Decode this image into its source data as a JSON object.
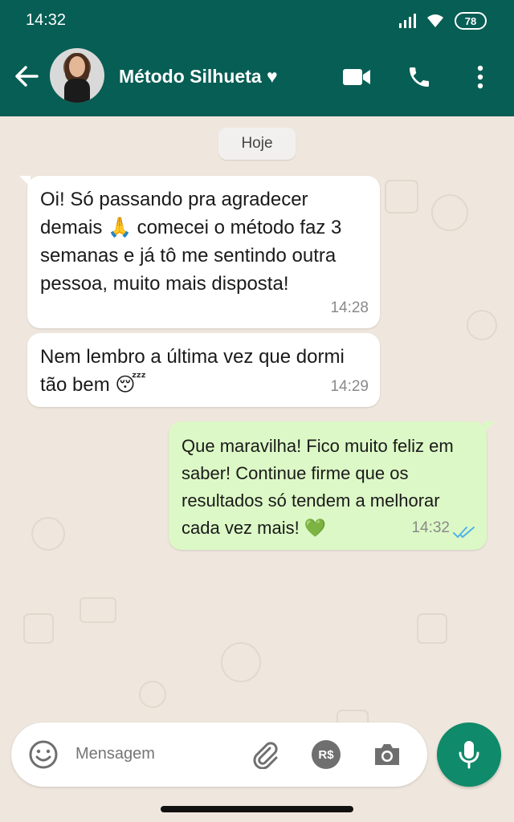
{
  "status_bar": {
    "time": "14:32",
    "battery": "78"
  },
  "header": {
    "contact_name": "Método Silhueta",
    "heart": "♥",
    "icons": [
      "back-arrow-icon",
      "video-call-icon",
      "phone-icon",
      "more-options-icon"
    ]
  },
  "chat": {
    "date_label": "Hoje",
    "messages": [
      {
        "direction": "incoming",
        "text": "Oi! Só passando pra agradecer demais 🙏 comecei o método faz 3 semanas e já tô me sentindo outra pessoa, muito mais disposta!",
        "time": "14:28"
      },
      {
        "direction": "incoming",
        "text": "Nem lembro a última vez que dormi tão bem 😴",
        "time": "14:29"
      },
      {
        "direction": "outgoing",
        "text": "Que maravilha! Fico muito feliz em saber! Continue firme que os resultados só tendem a melhorar cada vez mais! 💚",
        "time": "14:32",
        "status": "read"
      }
    ]
  },
  "composer": {
    "placeholder": "Mensagem",
    "payment_label": "R$",
    "icons": [
      "emoji-icon",
      "attach-icon",
      "payment-icon",
      "camera-icon",
      "mic-icon"
    ]
  },
  "colors": {
    "header": "#075e54",
    "outgoing_bubble": "#dcf8c6",
    "read_ticks": "#4fb3e8",
    "mic_button": "#0f8a6a"
  }
}
